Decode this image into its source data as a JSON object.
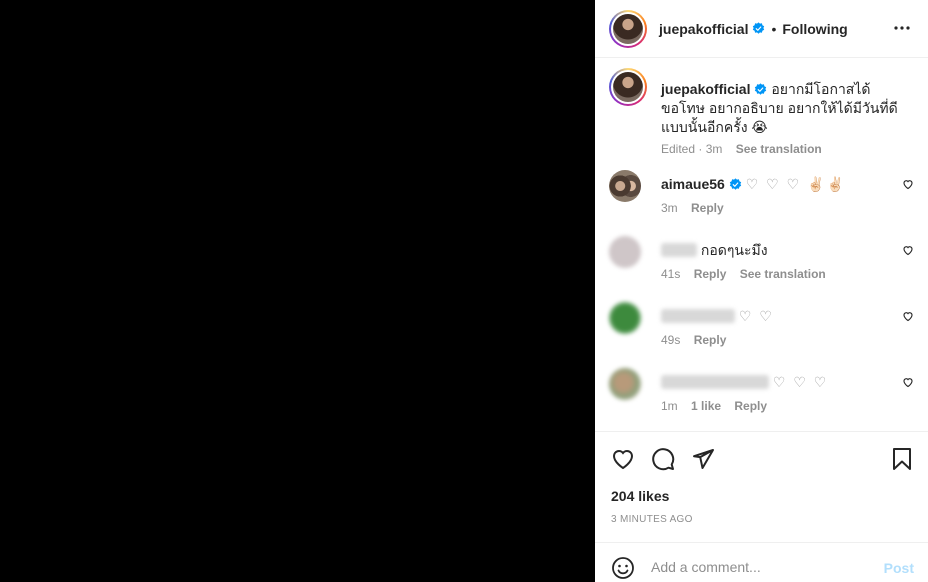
{
  "header": {
    "username": "juepakofficial",
    "separator": "•",
    "follow_status": "Following"
  },
  "caption": {
    "username": "juepakofficial",
    "text": "อยากมีโอกาสได้ขอโทษ อยากอธิบาย อยากให้ได้มีวันที่ดีแบบนั้นอีกครั้ง 😭",
    "edited": "Edited · 3m",
    "see_translation": "See translation"
  },
  "comments": [
    {
      "username": "aimaue56",
      "text": "♡ ♡ ♡ ✌🏻✌🏻",
      "time": "3m",
      "reply": "Reply"
    },
    {
      "text": "กอดๆนะมึง",
      "time": "41s",
      "reply": "Reply",
      "see_translation": "See translation"
    },
    {
      "text": "♡ ♡",
      "time": "49s",
      "reply": "Reply"
    },
    {
      "text": "♡ ♡ ♡",
      "time": "1m",
      "likes": "1 like",
      "reply": "Reply"
    }
  ],
  "actions": {
    "likes": "204 likes",
    "timestamp": "3 MINUTES AGO"
  },
  "add_comment": {
    "placeholder": "Add a comment...",
    "post_label": "Post"
  },
  "colors": {
    "verified": "#0095f6",
    "post_disabled": "#b2dffc",
    "muted": "#8e8e8e"
  }
}
